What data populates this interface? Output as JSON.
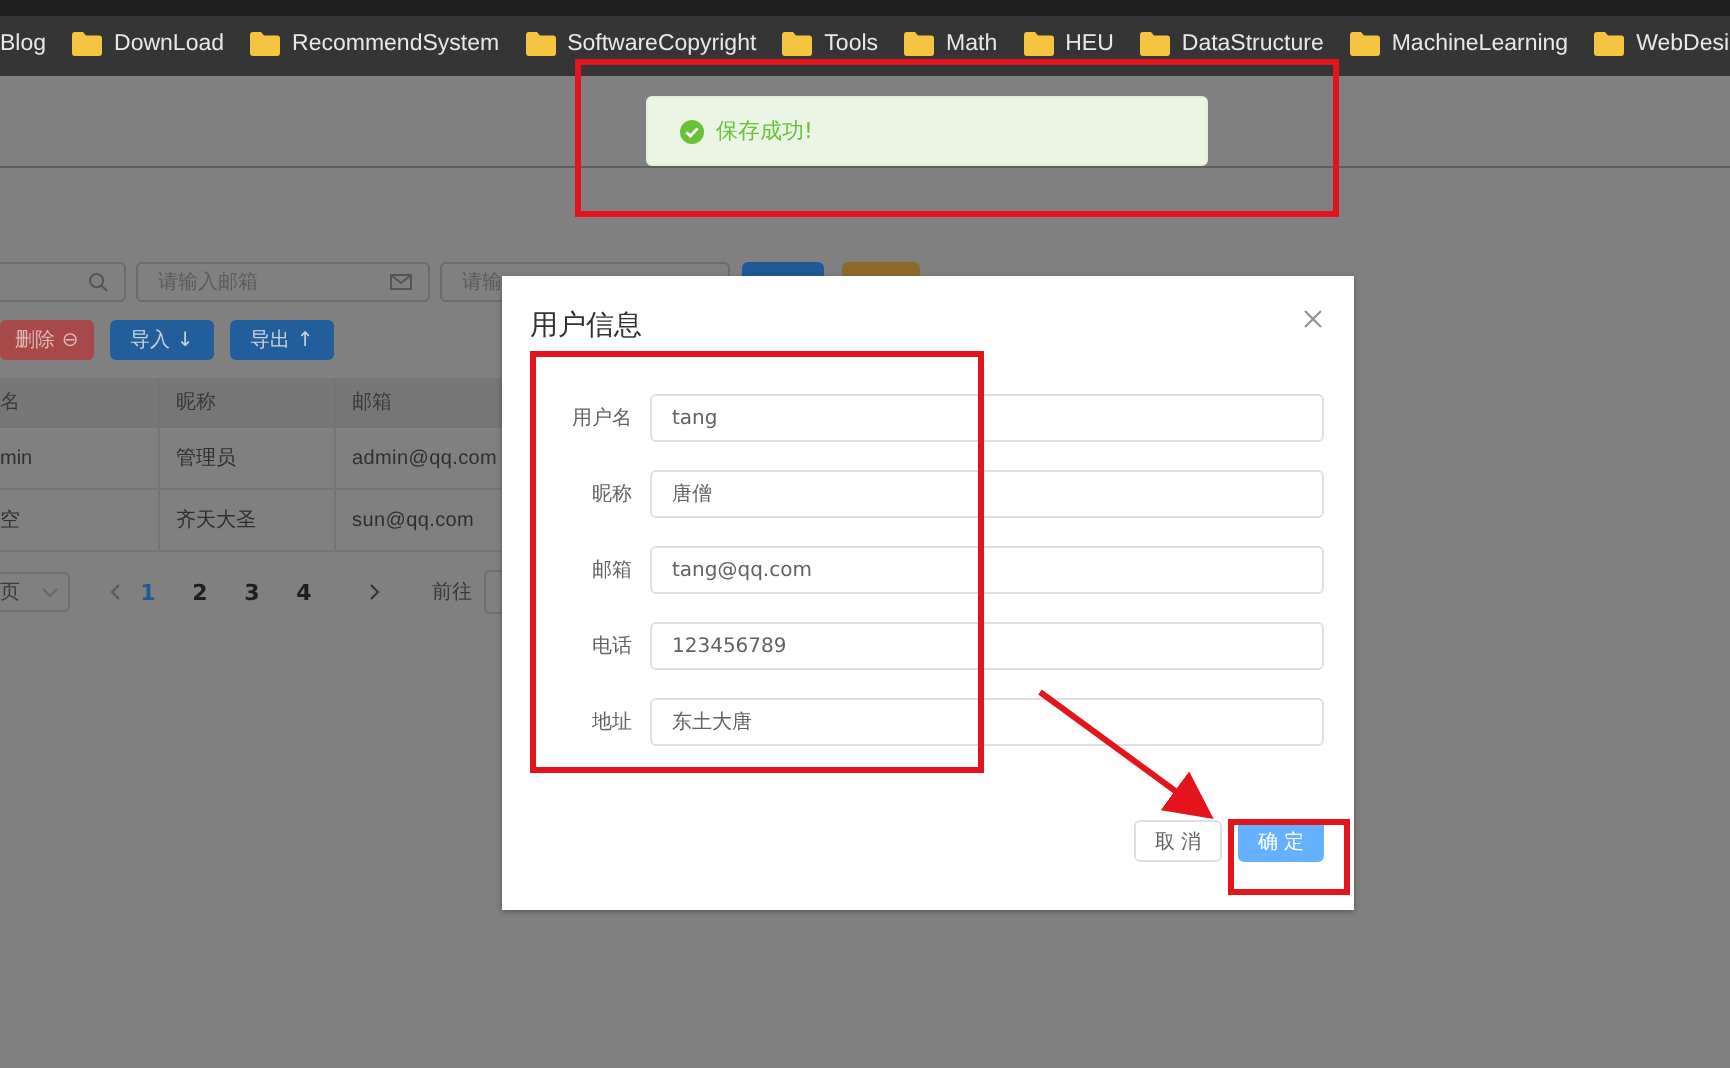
{
  "bookmarks": [
    {
      "label": "Blog",
      "kind": "link"
    },
    {
      "label": "DownLoad",
      "kind": "folder"
    },
    {
      "label": "RecommendSystem",
      "kind": "folder"
    },
    {
      "label": "SoftwareCopyright",
      "kind": "folder"
    },
    {
      "label": "Tools",
      "kind": "folder"
    },
    {
      "label": "Math",
      "kind": "folder"
    },
    {
      "label": "HEU",
      "kind": "folder"
    },
    {
      "label": "DataStructure",
      "kind": "folder"
    },
    {
      "label": "MachineLearning",
      "kind": "folder"
    },
    {
      "label": "WebDesi",
      "kind": "folder"
    }
  ],
  "toast": {
    "text": "保存成功!"
  },
  "page": {
    "search_fields": [
      {
        "kind": "search"
      },
      {
        "kind": "mail",
        "placeholder": "请输入邮箱"
      },
      {
        "kind": "plain",
        "placeholder": "请输"
      }
    ],
    "search_buttons": [
      {
        "kind": "primary"
      },
      {
        "kind": "warning"
      }
    ],
    "actions": [
      {
        "kind": "danger",
        "label": "删除 ⊖"
      },
      {
        "kind": "primary",
        "label": "导入 ↓"
      },
      {
        "kind": "primary",
        "label": "导出 ↑"
      }
    ],
    "table": {
      "columns": [
        "名",
        "昵称",
        "邮箱"
      ],
      "rows": [
        [
          "min",
          "管理员",
          "admin@qq.com"
        ],
        [
          "空",
          "齐天大圣",
          "sun@qq.com"
        ]
      ]
    },
    "pagination": {
      "page_size": "页",
      "pages": [
        {
          "label": "1",
          "selected": true
        },
        {
          "label": "2",
          "selected": false
        },
        {
          "label": "3",
          "selected": false
        },
        {
          "label": "4",
          "selected": false
        }
      ],
      "goto_label": "前往"
    }
  },
  "dialog": {
    "title": "用户信息",
    "fields": [
      {
        "label": "用户名",
        "value": "tang"
      },
      {
        "label": "昵称",
        "value": "唐僧"
      },
      {
        "label": "邮箱",
        "value": "tang@qq.com"
      },
      {
        "label": "电话",
        "value": "123456789"
      },
      {
        "label": "地址",
        "value": "东土大唐"
      }
    ],
    "buttons": [
      {
        "kind": "default",
        "label": "取 消"
      },
      {
        "kind": "primary",
        "label": "确 定"
      }
    ]
  }
}
